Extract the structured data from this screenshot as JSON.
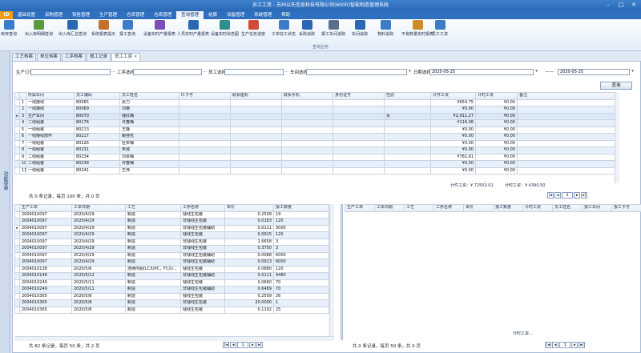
{
  "window": {
    "title": "员工工资 - 苏州以先信息科技有限公司(6000)智能制造管理系统 ",
    "logo": "ID"
  },
  "menu": [
    "基础设置",
    "采购管理",
    "销售管理",
    "生产管理",
    "仓库管理",
    "仓库管理",
    "查询管理",
    "结算",
    "设备管理",
    "系统管理",
    "帮助"
  ],
  "menu_active_index": 6,
  "ribbon": {
    "buttons": [
      "库存查询",
      "出入库明细查询",
      "出入库汇总查询",
      "系统报表提示",
      "报工查询",
      "设备实时产量报表",
      "人员实时产量报表",
      "设备实时状态图",
      "生产任务进度",
      "工单完工状态",
      "采购追踪",
      "报工车间追踪",
      "车间追踪",
      "物料追踪",
      "不良数量实时报表",
      "员工工资"
    ],
    "group_label": "查询业务"
  },
  "sidebar": {
    "label": "功能菜单"
  },
  "tabs": [
    {
      "label": "工艺档案"
    },
    {
      "label": "单位档案"
    },
    {
      "label": "工序档案"
    },
    {
      "label": "报工记录"
    },
    {
      "label": "员工工资"
    }
  ],
  "filter": {
    "order_label": "生产订单",
    "process_label": "工序选择",
    "employee_label": "员工选择",
    "workshop_label": "车间选择",
    "date_label": "日期选择",
    "date_from": "2020-05-25",
    "date_sep": "——",
    "date_to": "2020-05-25",
    "query_button": "查询"
  },
  "top_table": {
    "columns": [
      "所属车间",
      "员工编码",
      "员工姓名",
      "IC卡号",
      "联系座机",
      "联系手机",
      "身份证号",
      "性别",
      "计件工资",
      "计时工资",
      "备注"
    ],
    "rows": [
      {
        "n": "1",
        "workshop": "一线接线",
        "code": "80065",
        "name": "张力",
        "sex": "",
        "piece": "¥654.75",
        "time": "¥0.00"
      },
      {
        "n": "2",
        "workshop": "一线接线",
        "code": "80069",
        "name": "刘艳",
        "sex": "",
        "piece": "¥0.00",
        "time": "¥0.00"
      },
      {
        "n": "3",
        "workshop": "生产车间",
        "code": "80070",
        "name": "钱红梅",
        "sex": "女",
        "piece": "¥2,911.27",
        "time": "¥0.00"
      },
      {
        "n": "4",
        "workshop": "二线组装",
        "code": "80176",
        "name": "许春梅",
        "sex": "",
        "piece": "¥116.08",
        "time": "¥0.00"
      },
      {
        "n": "5",
        "workshop": "一线组装",
        "code": "80213",
        "name": "王静",
        "sex": "",
        "piece": "¥0.00",
        "time": "¥0.00"
      },
      {
        "n": "6",
        "workshop": "一线接线部件",
        "code": "80217",
        "name": "姚桂花",
        "sex": "",
        "piece": "¥0.00",
        "time": "¥0.00"
      },
      {
        "n": "7",
        "workshop": "一线组装",
        "code": "80226",
        "name": "杜宋梅",
        "sex": "",
        "piece": "¥0.00",
        "time": "¥0.00"
      },
      {
        "n": "8",
        "workshop": "一线组装",
        "code": "80231",
        "name": "朱城",
        "sex": "",
        "piece": "¥0.00",
        "time": "¥0.00"
      },
      {
        "n": "9",
        "workshop": "二线组装",
        "code": "80234",
        "name": "刘翠梅",
        "sex": "",
        "piece": "¥781.61",
        "time": "¥0.00"
      },
      {
        "n": "10",
        "workshop": "二线组装",
        "code": "80238",
        "name": "许春梅",
        "sex": "",
        "piece": "¥0.00",
        "time": "¥0.00"
      },
      {
        "n": "11",
        "workshop": "一线组装",
        "code": "80241",
        "name": "王伟",
        "sex": "",
        "piece": "¥0.00",
        "time": "¥0.00"
      }
    ],
    "sum_piece": "计件工资：¥ 72553.01",
    "sum_time": "计时工资：¥ 4390.50",
    "record_info": "共 0 条记录，每页 100 条，共 0 页",
    "page": "1"
  },
  "bottom_left_table": {
    "columns": [
      "生产工单",
      "工单日期",
      "工艺",
      "工序名称",
      "单价",
      "报工数量"
    ],
    "rows": [
      [
        "2004010097",
        "2020/4/29",
        "制造",
        "钱线生包装",
        "0.2508",
        "19"
      ],
      [
        "2004010097",
        "2020/4/29",
        "制造",
        "非钱线生包装",
        "0.0183",
        "120"
      ],
      [
        "2004010097",
        "2020/4/29",
        "制造",
        "非钱线生包装辅助",
        "0.0111",
        "3000"
      ],
      [
        "2004010097",
        "2020/4/29",
        "制造",
        "钱线生包装",
        "0.0915",
        "120"
      ],
      [
        "2004010097",
        "2020/4/29",
        "制造",
        "非钱线生包装",
        "1.6658",
        "3"
      ],
      [
        "2004010097",
        "2020/4/29",
        "制造",
        "非钱线生包装",
        "0.3750",
        "3"
      ],
      [
        "2004010097",
        "2020/4/29",
        "制造",
        "非钱线生包装辅助",
        "0.0088",
        "6000"
      ],
      [
        "2004010097",
        "2020/4/29",
        "制造",
        "非钱线生包装辅助",
        "0.0913",
        "6000"
      ],
      [
        "2004010138",
        "2020/5/6",
        "连续内组(LC/UPC，FC/U...",
        "钱线生包装",
        "0.0880",
        "120"
      ],
      [
        "2004010148",
        "2020/5/12",
        "制造",
        "非钱线生包装辅助",
        "0.0111",
        "4480"
      ],
      [
        "2004010249",
        "2020/5/11",
        "制造",
        "钱线生包装",
        "0.0660",
        "70"
      ],
      [
        "2004010249",
        "2020/5/11",
        "制造",
        "非钱线生包装辅助",
        "0.6489",
        "70"
      ],
      [
        "2004010365",
        "2020/5/8",
        "制造",
        "钱线生包装",
        "0.2509",
        "26"
      ],
      [
        "2004010365",
        "2020/5/8",
        "制造",
        "非钱线生包装",
        "20.0000",
        "1"
      ],
      [
        "2004010365",
        "2020/5/8",
        "制造",
        "钱线生包装",
        "0.1192",
        "25"
      ]
    ],
    "record_info": "共 82 条记录，每页 50 条，共 2 页",
    "page": "1"
  },
  "bottom_right_table": {
    "columns": [
      "生产工单",
      "工单日期",
      "工艺",
      "工序名称",
      "单价",
      "报工数量",
      "计时工资",
      "员工姓名",
      "报工车间",
      "报工卡号"
    ],
    "sum_time": "计时工资...",
    "record_info": "共 0 条记录，每页 50 条，共 0 页",
    "page": "1"
  },
  "colors": {
    "titlebar": "#2a68b5",
    "menubar": "#2f6fbf",
    "logo": "#f39c1e",
    "selected_row": "#dbe8f7",
    "alt_row": "#e7f0fa"
  }
}
